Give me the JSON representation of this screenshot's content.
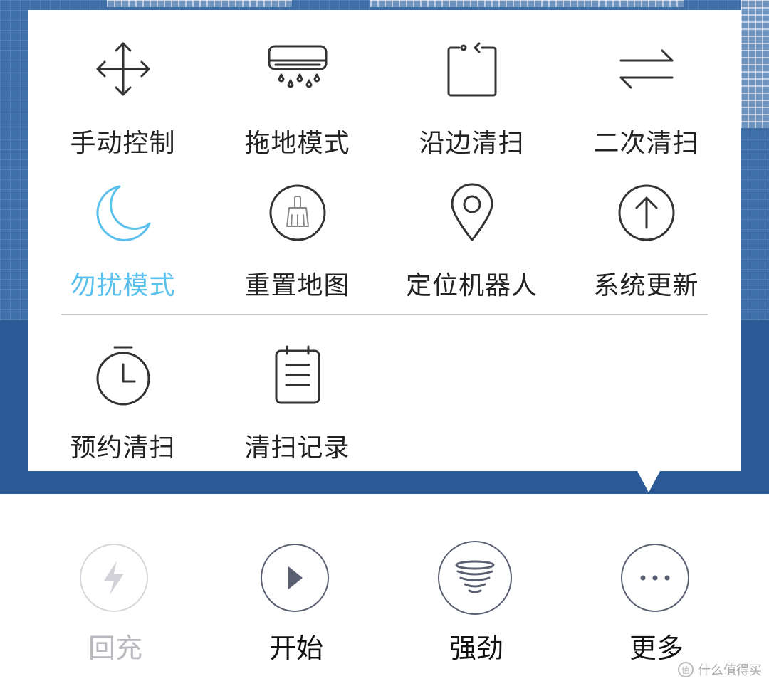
{
  "menu": {
    "items": [
      {
        "label": "手动控制",
        "icon": "move-arrows-icon",
        "active": false
      },
      {
        "label": "拖地模式",
        "icon": "mop-water-icon",
        "active": false
      },
      {
        "label": "沿边清扫",
        "icon": "edge-clean-icon",
        "active": false
      },
      {
        "label": "二次清扫",
        "icon": "swap-arrows-icon",
        "active": false
      },
      {
        "label": "勿扰模式",
        "icon": "moon-icon",
        "active": true
      },
      {
        "label": "重置地图",
        "icon": "broom-icon",
        "active": false
      },
      {
        "label": "定位机器人",
        "icon": "location-pin-icon",
        "active": false
      },
      {
        "label": "系统更新",
        "icon": "upload-arrow-icon",
        "active": false
      },
      {
        "label": "预约清扫",
        "icon": "timer-icon",
        "active": false
      },
      {
        "label": "清扫记录",
        "icon": "clipboard-icon",
        "active": false
      }
    ]
  },
  "bottom_bar": {
    "buttons": [
      {
        "label": "回充",
        "icon": "lightning-icon",
        "enabled": false
      },
      {
        "label": "开始",
        "icon": "play-icon",
        "enabled": true
      },
      {
        "label": "强劲",
        "icon": "tornado-icon",
        "enabled": true
      },
      {
        "label": "更多",
        "icon": "more-dots-icon",
        "enabled": true
      }
    ]
  },
  "watermark": {
    "text": "什么值得买",
    "logo_text": "值"
  },
  "colors": {
    "accent": "#5cc0ec",
    "map_light": "#3f6fa8",
    "map_dark": "#2b5a96",
    "icon_stroke": "#333333"
  }
}
